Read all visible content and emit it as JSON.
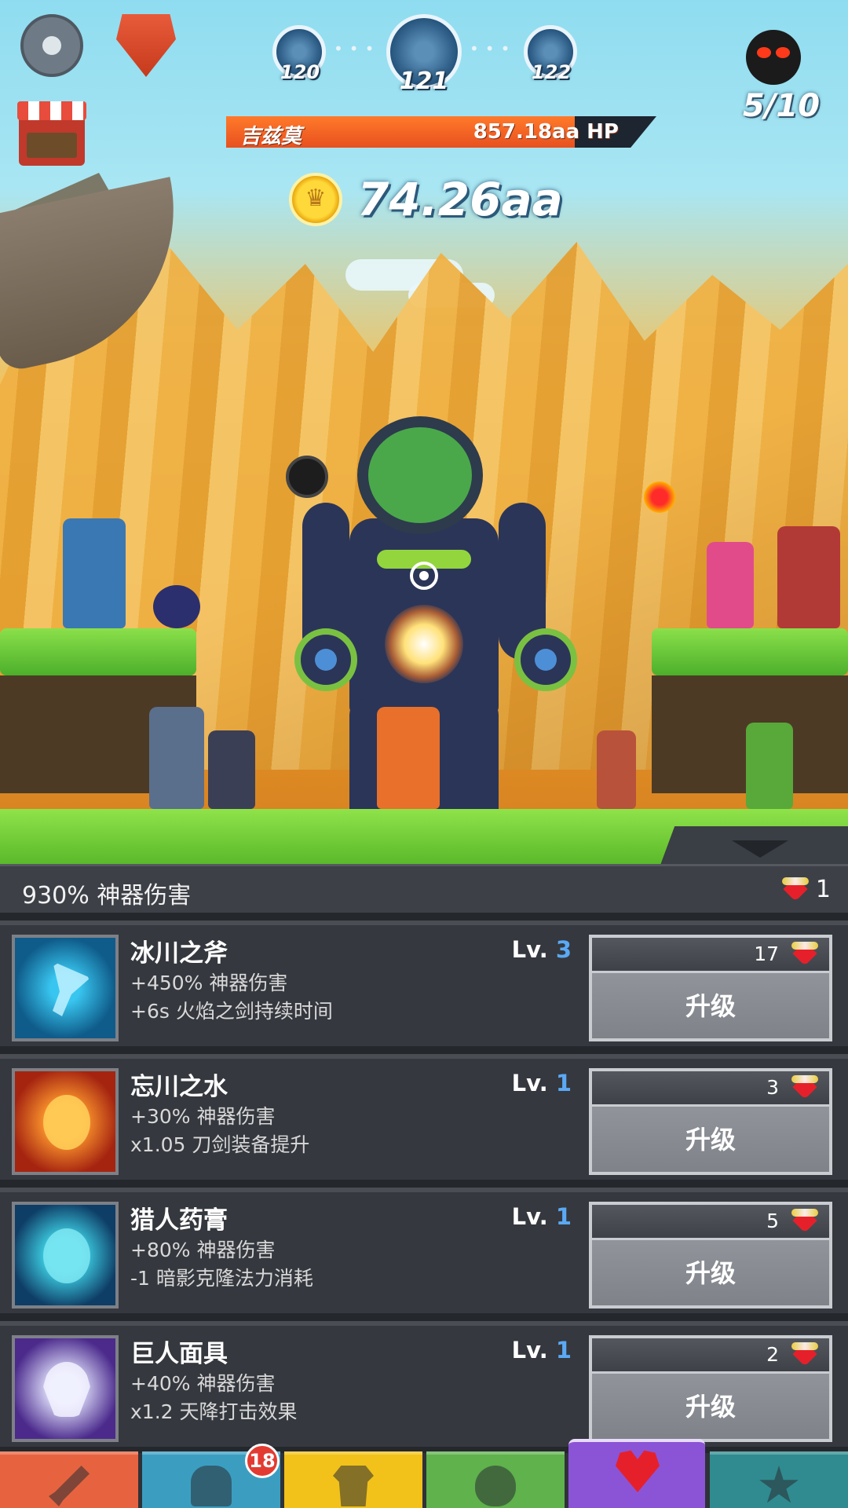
{
  "hud": {
    "stages": [
      "120",
      "121",
      "122"
    ],
    "boss_name": "吉兹莫",
    "boss_hp": "857.18aa HP",
    "boss_hp_fraction": 0.81,
    "gold": "74.26aa",
    "wave": "5/10"
  },
  "panel": {
    "summary": "930% 神器伤害",
    "relic_count": "1"
  },
  "artifacts": [
    {
      "name": "冰川之斧",
      "effect1": "+450% 神器伤害",
      "effect2": "+6s 火焰之剑持续时间",
      "level_prefix": "Lv. ",
      "level": "3",
      "cost": "17",
      "button": "升级"
    },
    {
      "name": "忘川之水",
      "effect1": "+30% 神器伤害",
      "effect2": "x1.05 刀剑装备提升",
      "level_prefix": "Lv. ",
      "level": "1",
      "cost": "3",
      "button": "升级"
    },
    {
      "name": "猎人药膏",
      "effect1": "+80% 神器伤害",
      "effect2": "-1 暗影克隆法力消耗",
      "level_prefix": "Lv. ",
      "level": "1",
      "cost": "5",
      "button": "升级"
    },
    {
      "name": "巨人面具",
      "effect1": "+40% 神器伤害",
      "effect2": "x1.2 天降打击效果",
      "level_prefix": "Lv. ",
      "level": "1",
      "cost": "2",
      "button": "升级"
    }
  ],
  "nav": {
    "tabs": [
      "sword-icon",
      "hero-helmet-icon",
      "shirt-icon",
      "pet-icon",
      "artifact-heart-icon",
      "star-icon"
    ],
    "active": "artifact-heart-icon",
    "hero_badge": "18"
  },
  "colors": {
    "hp_fill": "#e8501f",
    "level_number": "#5aa9f5",
    "nav_active": "#8b54d6"
  }
}
